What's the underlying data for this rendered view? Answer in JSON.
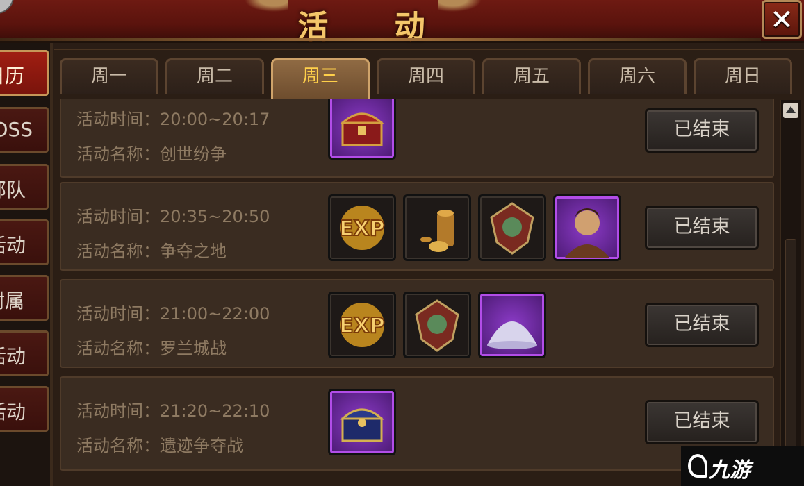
{
  "header": {
    "title": "活 动",
    "close_icon": "close-x-icon"
  },
  "sidebar": {
    "items": [
      {
        "label": "日历",
        "active": true
      },
      {
        "label": "OSS",
        "active": false
      },
      {
        "label": "部队",
        "active": false
      },
      {
        "label": "活动",
        "active": false
      },
      {
        "label": "附属",
        "active": false
      },
      {
        "label": "活动",
        "active": false
      },
      {
        "label": "活动",
        "active": false
      }
    ]
  },
  "tabs": [
    {
      "label": "周一",
      "active": false
    },
    {
      "label": "周二",
      "active": false
    },
    {
      "label": "周三",
      "active": true
    },
    {
      "label": "周四",
      "active": false
    },
    {
      "label": "周五",
      "active": false
    },
    {
      "label": "周六",
      "active": false
    },
    {
      "label": "周日",
      "active": false
    }
  ],
  "labels": {
    "time_label": "活动时间：",
    "name_label": "活动名称："
  },
  "events": [
    {
      "time": "20:00~20:17",
      "name": "创世纷争",
      "status": "已结束",
      "rewards": [
        "treasure-chest-red-icon"
      ]
    },
    {
      "time": "20:35~20:50",
      "name": "争夺之地",
      "status": "已结束",
      "rewards": [
        "exp-icon",
        "gold-coins-icon",
        "emblem-shield-icon",
        "hero-portrait-icon"
      ]
    },
    {
      "time": "21:00~22:00",
      "name": "罗兰城战",
      "status": "已结束",
      "rewards": [
        "exp-icon",
        "emblem-shield-icon",
        "powder-pile-icon"
      ]
    },
    {
      "time": "21:20~22:10",
      "name": "遗迹争夺战",
      "status": "已结束",
      "rewards": [
        "treasure-chest-blue-icon"
      ]
    }
  ],
  "watermark": {
    "text": "九游"
  }
}
